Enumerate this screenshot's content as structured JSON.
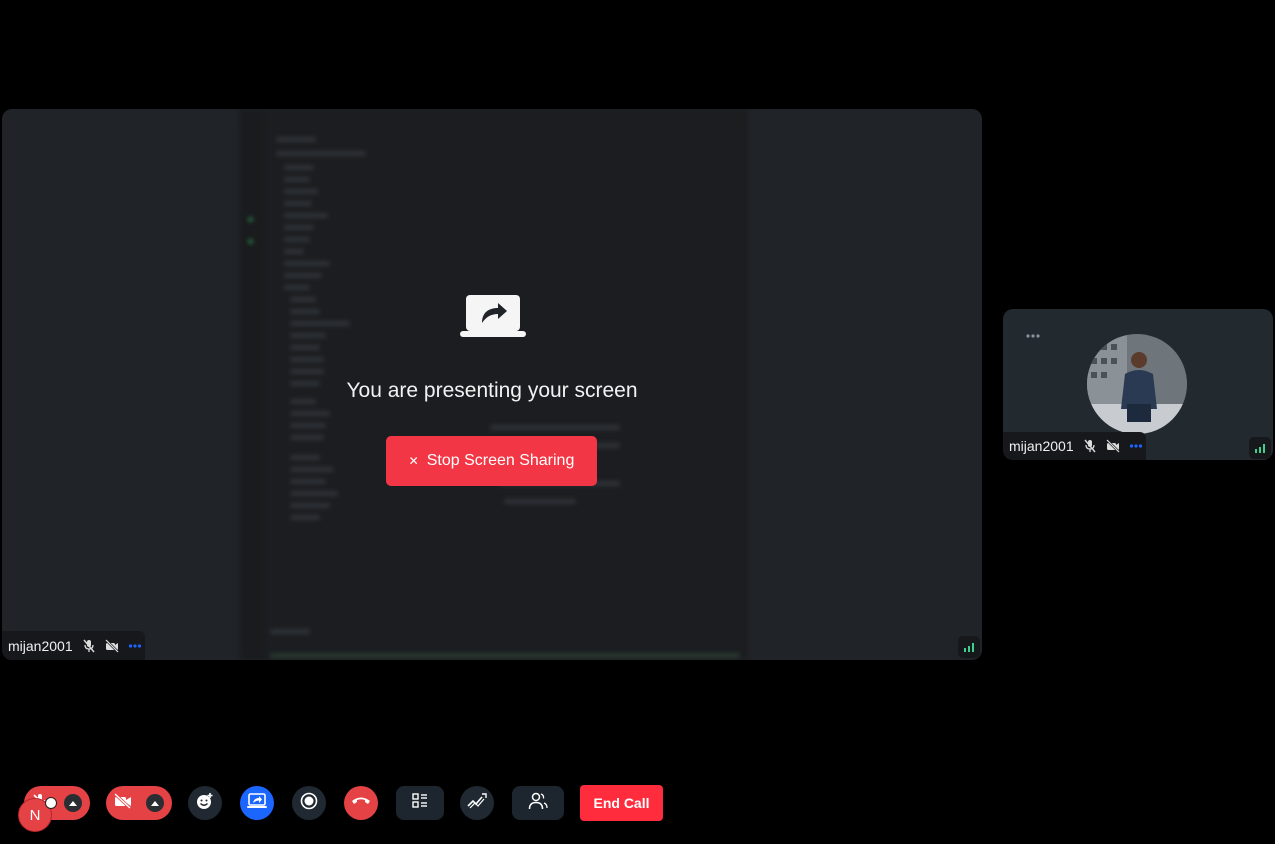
{
  "main_tile": {
    "presenting_text": "You are presenting your screen",
    "stop_button_label": "Stop Screen Sharing",
    "stop_button_icon": "x-icon",
    "participant_name": "mijan2001",
    "icons": [
      "laptop-share-icon",
      "mic-off-icon",
      "video-off-icon",
      "more-icon",
      "signal-icon"
    ]
  },
  "side_tile": {
    "participant_name": "mijan2001",
    "icons": [
      "more-icon",
      "mic-off-icon",
      "video-off-icon",
      "more-icon",
      "signal-icon"
    ]
  },
  "toolbar": {
    "buttons": [
      {
        "name": "mic-toggle",
        "icon": "mic-off-icon",
        "state": "off"
      },
      {
        "name": "camera-toggle",
        "icon": "video-off-icon",
        "state": "off"
      },
      {
        "name": "reactions",
        "icon": "emoji-add-icon"
      },
      {
        "name": "screen-share",
        "icon": "screen-share-icon",
        "state": "active"
      },
      {
        "name": "record",
        "icon": "record-icon"
      },
      {
        "name": "leave",
        "icon": "phone-hangup-icon"
      },
      {
        "name": "layout",
        "icon": "layout-icon"
      },
      {
        "name": "whiteboard",
        "icon": "whiteboard-icon"
      },
      {
        "name": "participants",
        "icon": "participants-icon"
      }
    ],
    "end_call_label": "End Call"
  },
  "user_avatar_initial": "N",
  "colors": {
    "background": "#000000",
    "tile": "#202327",
    "danger": "#f23645",
    "primary": "#1a66ff",
    "control_dark": "#202932",
    "signal_green": "#3ecf8e"
  }
}
